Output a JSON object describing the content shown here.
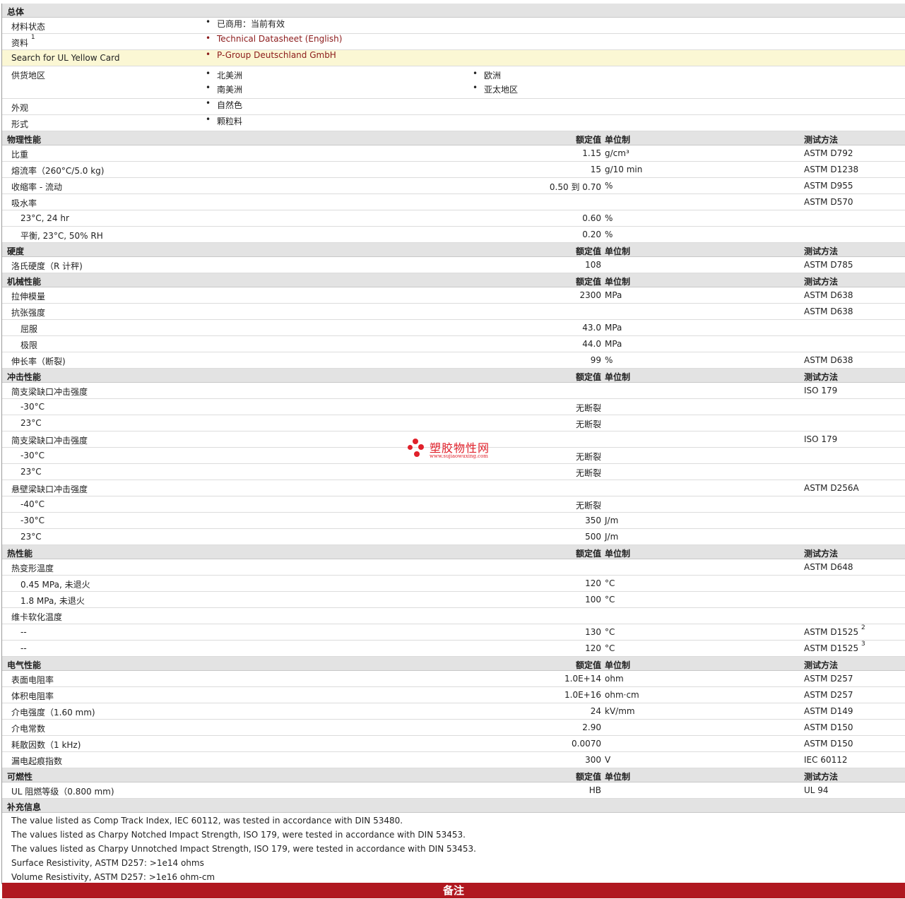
{
  "general": {
    "title": "总体",
    "rows": [
      {
        "label": "材料状态",
        "values": [
          "已商用：当前有效"
        ]
      },
      {
        "label": "资料",
        "sup": "1",
        "values": [
          "Technical Datasheet (English)"
        ]
      },
      {
        "label": "Search for UL Yellow Card",
        "values": [
          "P-Group Deutschland GmbH"
        ]
      },
      {
        "label": "供货地区",
        "values": [
          "北美洲",
          "欧洲",
          "南美洲",
          "亚太地区"
        ]
      },
      {
        "label": "外观",
        "values": [
          "自然色"
        ]
      },
      {
        "label": "形式",
        "values": [
          "颗粒料"
        ]
      }
    ]
  },
  "headers": {
    "value": "额定值",
    "unit": "单位制",
    "method": "测试方法"
  },
  "physical": {
    "title": "物理性能",
    "rows": [
      {
        "label": "比重",
        "value": "1.15",
        "unit": "g/cm³",
        "method": "ASTM D792"
      },
      {
        "label": "熔流率（260°C/5.0 kg)",
        "value": "15",
        "unit": "g/10 min",
        "method": "ASTM D1238"
      },
      {
        "label": "收缩率 - 流动",
        "value": "0.50 到 0.70",
        "unit": "%",
        "method": "ASTM D955"
      },
      {
        "label": "吸水率",
        "value": "",
        "unit": "",
        "method": "ASTM D570"
      },
      {
        "label": "23°C, 24 hr",
        "value": "0.60",
        "unit": "%",
        "method": ""
      },
      {
        "label": "平衡, 23°C, 50% RH",
        "value": "0.20",
        "unit": "%",
        "method": ""
      }
    ]
  },
  "hardness": {
    "title": "硬度",
    "rows": [
      {
        "label": "洛氏硬度（R 计秤)",
        "value": "108",
        "unit": "",
        "method": "ASTM D785"
      }
    ]
  },
  "mechanical": {
    "title": "机械性能",
    "rows": [
      {
        "label": "拉伸模量",
        "value": "2300",
        "unit": "MPa",
        "method": "ASTM D638"
      },
      {
        "label": "抗张强度",
        "value": "",
        "unit": "",
        "method": "ASTM D638"
      },
      {
        "label": "屈服",
        "value": "43.0",
        "unit": "MPa",
        "method": ""
      },
      {
        "label": "极限",
        "value": "44.0",
        "unit": "MPa",
        "method": ""
      },
      {
        "label": "伸长率（断裂)",
        "value": "99",
        "unit": "%",
        "method": "ASTM D638"
      }
    ]
  },
  "impact": {
    "title": "冲击性能",
    "rows": [
      {
        "label": "简支梁缺口冲击强度",
        "value": "",
        "unit": "",
        "method": "ISO 179"
      },
      {
        "label": "-30°C",
        "value": "无断裂",
        "unit": "",
        "method": ""
      },
      {
        "label": "23°C",
        "value": "无断裂",
        "unit": "",
        "method": ""
      },
      {
        "label": "简支梁缺口冲击强度",
        "value": "",
        "unit": "",
        "method": "ISO 179"
      },
      {
        "label": "-30°C",
        "value": "无断裂",
        "unit": "",
        "method": ""
      },
      {
        "label": "23°C",
        "value": "无断裂",
        "unit": "",
        "method": ""
      },
      {
        "label": "悬壁梁缺口冲击强度",
        "value": "",
        "unit": "",
        "method": "ASTM D256A"
      },
      {
        "label": "-40°C",
        "value": "无断裂",
        "unit": "",
        "method": ""
      },
      {
        "label": "-30°C",
        "value": "350",
        "unit": "J/m",
        "method": ""
      },
      {
        "label": "23°C",
        "value": "500",
        "unit": "J/m",
        "method": ""
      }
    ]
  },
  "thermal": {
    "title": "热性能",
    "rows": [
      {
        "label": "热变形温度",
        "value": "",
        "unit": "",
        "method": "ASTM D648"
      },
      {
        "label": "0.45 MPa, 未退火",
        "value": "120",
        "unit": "°C",
        "method": ""
      },
      {
        "label": "1.8 MPa, 未退火",
        "value": "100",
        "unit": "°C",
        "method": ""
      },
      {
        "label": "维卡软化温度",
        "value": "",
        "unit": "",
        "method": ""
      },
      {
        "label": "--",
        "value": "130",
        "unit": "°C",
        "method": "ASTM D1525",
        "sup": "2"
      },
      {
        "label": "--",
        "value": "120",
        "unit": "°C",
        "method": "ASTM D1525",
        "sup": "3"
      }
    ]
  },
  "electrical": {
    "title": "电气性能",
    "rows": [
      {
        "label": "表面电阻率",
        "value": "1.0E+14",
        "unit": "ohm",
        "method": "ASTM D257"
      },
      {
        "label": "体积电阻率",
        "value": "1.0E+16",
        "unit": "ohm·cm",
        "method": "ASTM D257"
      },
      {
        "label": "介电强度（1.60 mm)",
        "value": "24",
        "unit": "kV/mm",
        "method": "ASTM D149"
      },
      {
        "label": "介电常数",
        "value": "2.90",
        "unit": "",
        "method": "ASTM D150"
      },
      {
        "label": "耗散因数（1 kHz)",
        "value": "0.0070",
        "unit": "",
        "method": "ASTM D150"
      },
      {
        "label": "漏电起痕指数",
        "value": "300",
        "unit": "V",
        "method": "IEC 60112"
      }
    ]
  },
  "flammability": {
    "title": "可燃性",
    "rows": [
      {
        "label": "UL 阻燃等级（0.800 mm)",
        "value": "HB",
        "unit": "",
        "method": "UL 94"
      }
    ]
  },
  "supplement": {
    "title": "补充信息",
    "notes": [
      "The value listed as Comp Track Index, IEC 60112, was tested in accordance with DIN 53480.",
      "The values listed as Charpy Notched Impact Strength, ISO 179, were tested in accordance with DIN 53453.",
      "The values listed as Charpy Unnotched Impact Strength, ISO 179, were tested in accordance with DIN 53453.",
      "Surface Resistivity, ASTM D257: >1e14 ohms",
      "Volume Resistivity, ASTM D257: >1e16 ohm-cm"
    ]
  },
  "footer": {
    "label": "备注"
  },
  "watermark": {
    "name": "塑胶物性网",
    "url": "www.sujiaowuxing.com"
  },
  "colors": {
    "section_bg": "#e3e3e3",
    "highlight_bg": "#fbf7d4",
    "link": "#8b1a1a",
    "footer_bg": "#b01820"
  }
}
